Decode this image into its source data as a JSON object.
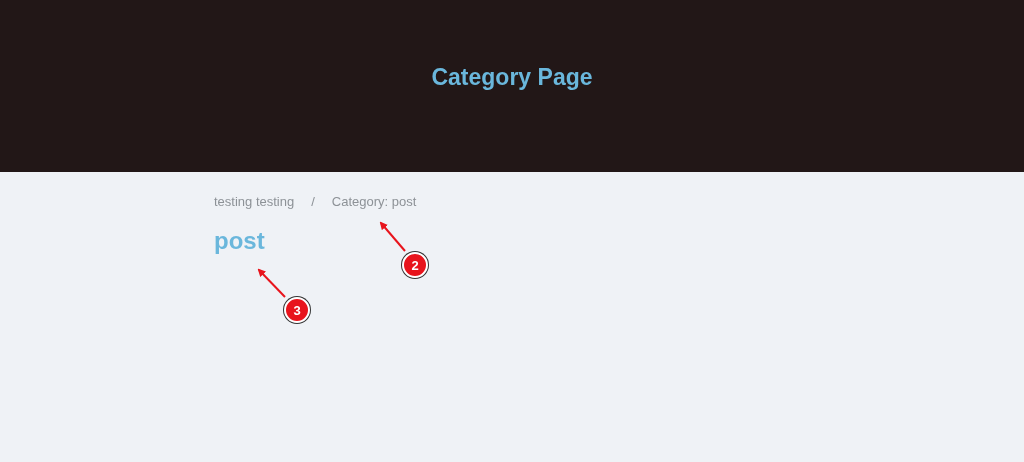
{
  "header": {
    "title": "Category Page"
  },
  "breadcrumb": {
    "items": [
      "testing testing",
      "Category: post"
    ],
    "separator": "/"
  },
  "heading": "post",
  "annotations": [
    {
      "number": "2"
    },
    {
      "number": "3"
    }
  ]
}
